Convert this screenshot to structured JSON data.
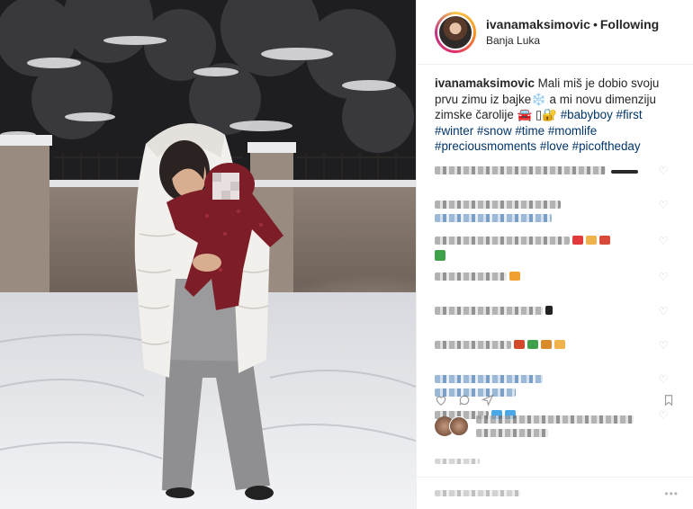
{
  "header": {
    "username": "ivanamaksimovic",
    "separator": "•",
    "follow_label": "Following",
    "location": "Banja Luka"
  },
  "caption": {
    "username": "ivanamaksimovic",
    "text": "Mali miš je dobio svoju prvu zimu iz bajke❄️ a mi novu dimenziju zimske čarolije 🚘 ▯🔐",
    "hashtags": [
      "#babyboy",
      "#first",
      "#winter",
      "#snow",
      "#time",
      "#momlife",
      "#preciousmoments",
      "#love",
      "#picoftheday"
    ]
  },
  "comments": [
    {
      "lines": 1,
      "style": "gray",
      "widths": [
        190
      ],
      "extra_width": 30
    },
    {
      "lines": 2,
      "style": "mixed",
      "widths": [
        140,
        130
      ]
    },
    {
      "lines": 2,
      "style": "gray",
      "widths": [
        215,
        12
      ],
      "emoji": [
        "#e03a3a",
        "#f0b24a",
        "#d94a3a"
      ]
    },
    {
      "lines": 1,
      "style": "gray",
      "widths": [
        80
      ],
      "emoji": [
        "#f0a030"
      ]
    },
    {
      "lines": 1,
      "style": "gray",
      "widths": [
        130
      ]
    },
    {
      "lines": 1,
      "style": "gray",
      "widths": [
        85
      ],
      "emoji": [
        "#d24a2a",
        "#3fa14a",
        "#d98a2a",
        "#f0b24a"
      ]
    },
    {
      "lines": 2,
      "style": "blue",
      "widths": [
        120,
        90
      ]
    },
    {
      "lines": 1,
      "style": "gray",
      "widths": [
        60
      ],
      "emoji": [
        "#4aa8e8",
        "#4aa8e8"
      ]
    }
  ],
  "icons": [
    "heart-icon",
    "comment-icon",
    "share-icon",
    "bookmark-icon",
    "more-options-icon"
  ],
  "colors": {
    "hashtag": "#003569",
    "text": "#262626",
    "border": "#efefef"
  }
}
